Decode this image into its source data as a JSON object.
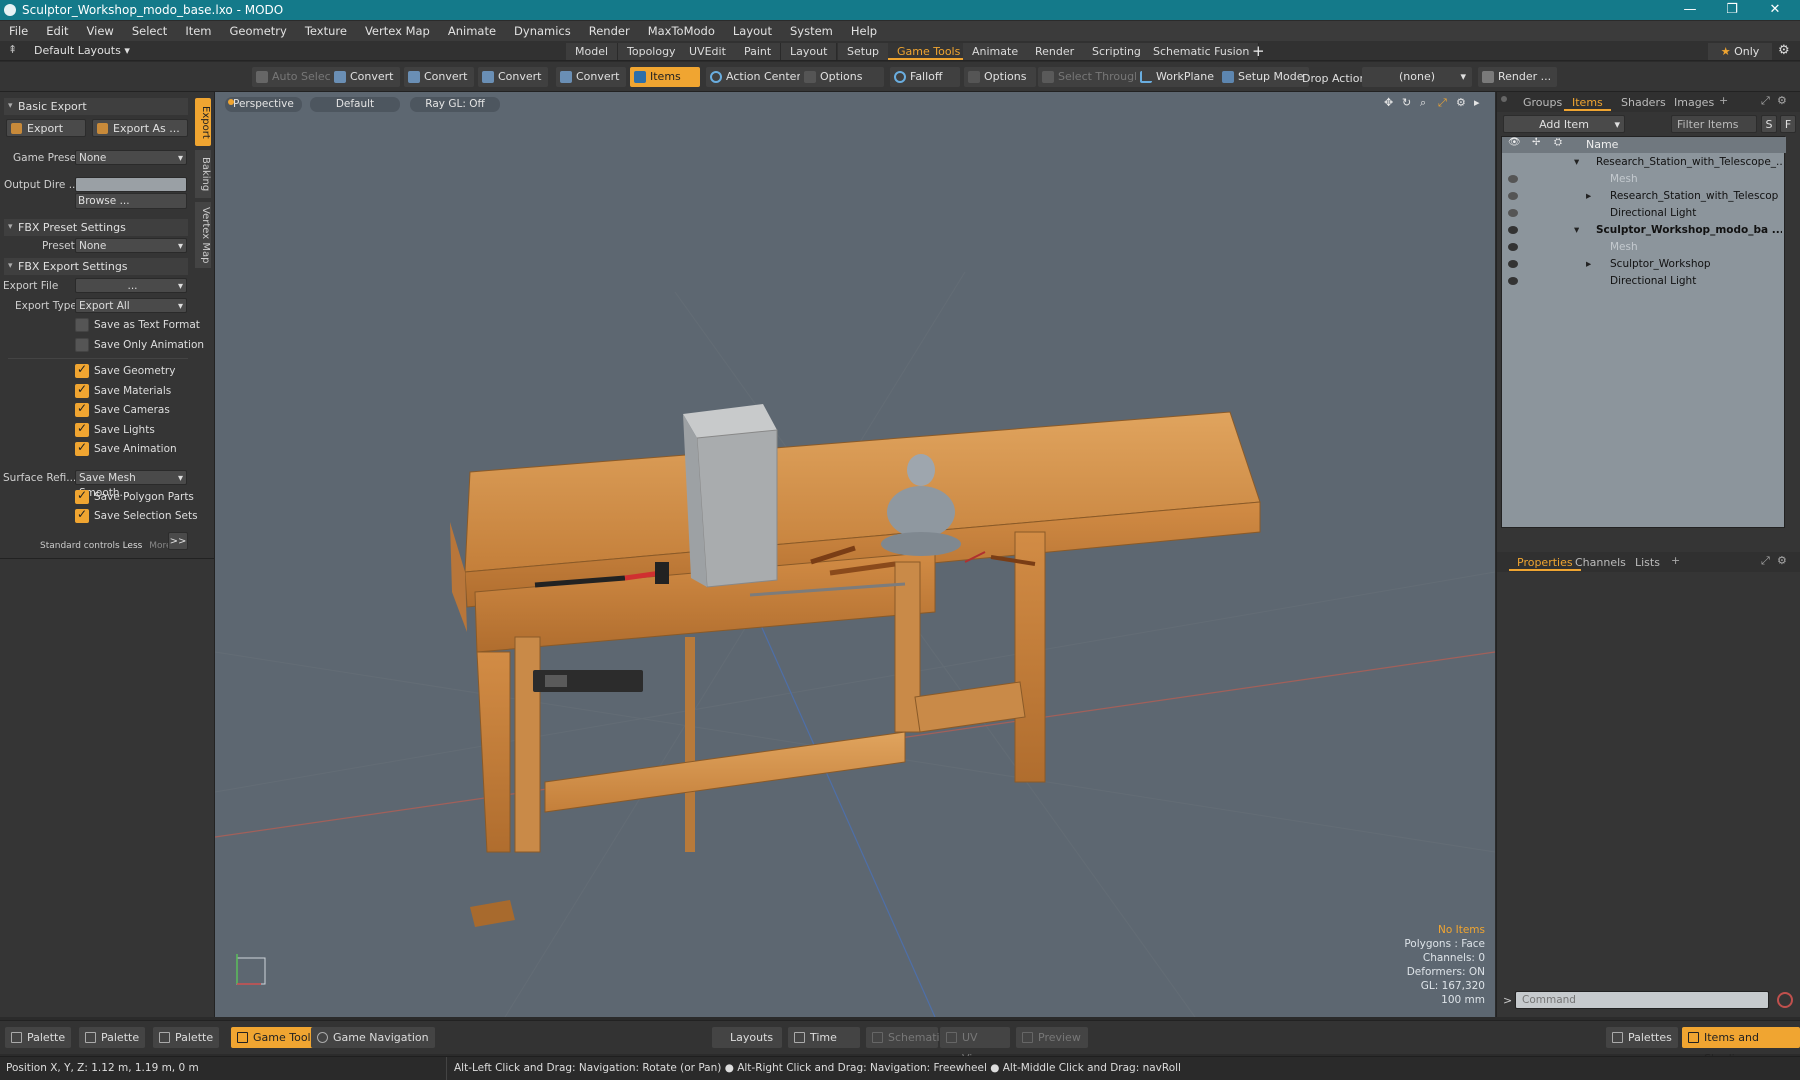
{
  "window": {
    "title": "Sculptor_Workshop_modo_base.lxo - MODO"
  },
  "menu": [
    "File",
    "Edit",
    "View",
    "Select",
    "Item",
    "Geometry",
    "Texture",
    "Vertex Map",
    "Animate",
    "Dynamics",
    "Render",
    "MaxToModo",
    "Layout",
    "System",
    "Help"
  ],
  "layout_bar": {
    "preset": "Default Layouts",
    "tabs": [
      "Model",
      "Topology",
      "UVEdit",
      "Paint",
      "Layout",
      "Setup",
      "Game Tools",
      "Animate",
      "Render",
      "Scripting",
      "Schematic Fusion"
    ],
    "add": "+",
    "only": "Only"
  },
  "toolbar": {
    "auto_select": "Auto Select",
    "convert1": "Convert",
    "convert2": "Convert",
    "convert3": "Convert",
    "convert4": "Convert",
    "items": "Items",
    "action_center": "Action Center",
    "options1": "Options",
    "falloff": "Falloff",
    "options2": "Options",
    "select_through": "Select Through",
    "workplane": "WorkPlane",
    "setup_mode": "Setup Mode",
    "drop_action_label": "Drop Action",
    "drop_action_value": "(none)",
    "render": "Render ..."
  },
  "left": {
    "basic_export": "Basic Export",
    "export_btn": "Export",
    "export_as_btn": "Export As ...",
    "game_preset_label": "Game Preset",
    "game_preset_value": "None",
    "output_dir_label": "Output Dire ...",
    "browse": "Browse ...",
    "fbx_preset_settings": "FBX Preset Settings",
    "preset_label": "Preset",
    "preset_value": "None",
    "fbx_export_settings": "FBX Export Settings",
    "export_file_label": "Export File",
    "export_file_value": "...",
    "export_type_label": "Export Type",
    "export_type_value": "Export All",
    "checks": [
      {
        "label": "Save as Text Format",
        "on": false
      },
      {
        "label": "Save Only Animation",
        "on": false
      },
      {
        "label": "Save Geometry",
        "on": true
      },
      {
        "label": "Save Materials",
        "on": true
      },
      {
        "label": "Save Cameras",
        "on": true
      },
      {
        "label": "Save Lights",
        "on": true
      },
      {
        "label": "Save Animation",
        "on": true
      }
    ],
    "surface_label": "Surface Refi...",
    "surface_value": "Save Mesh Smooth...",
    "checks2": [
      {
        "label": "Save Polygon Parts",
        "on": true
      },
      {
        "label": "Save Selection Sets",
        "on": true
      }
    ],
    "std_controls": "Standard controls",
    "less": "Less",
    "more": "More",
    "expand": ">>",
    "side_tabs": [
      "Export",
      "Baking",
      "Vertex Map"
    ]
  },
  "viewport": {
    "view": "Perspective",
    "shading": "Default",
    "raygl": "Ray GL: Off",
    "info": {
      "no_items": "No Items",
      "polygons": "Polygons : Face",
      "channels": "Channels: 0",
      "deformers": "Deformers: ON",
      "gl": "GL: 167,320",
      "scale": "100 mm"
    }
  },
  "right": {
    "tabs": [
      "Groups",
      "Items",
      "Shaders",
      "Images"
    ],
    "add_item": "Add Item",
    "filter_items": "Filter Items",
    "s": "S",
    "f": "F",
    "name_col": "Name",
    "items": [
      {
        "name": "Research_Station_with_Telescope_...",
        "indent": 0,
        "bold": false,
        "arrow": "▾"
      },
      {
        "name": "Mesh",
        "indent": 1,
        "bold": false,
        "arrow": "",
        "dim": true
      },
      {
        "name": "Research_Station_with_Telescop ...",
        "indent": 1,
        "bold": false,
        "arrow": "▸"
      },
      {
        "name": "Directional Light",
        "indent": 1,
        "bold": false,
        "arrow": ""
      },
      {
        "name": "Sculptor_Workshop_modo_ba ...",
        "indent": 0,
        "bold": true,
        "arrow": "▾"
      },
      {
        "name": "Mesh",
        "indent": 1,
        "bold": false,
        "arrow": "",
        "dim": true
      },
      {
        "name": "Sculptor_Workshop",
        "indent": 1,
        "bold": false,
        "arrow": "▸"
      },
      {
        "name": "Directional Light",
        "indent": 1,
        "bold": false,
        "arrow": ""
      }
    ],
    "prop_tabs": [
      "Properties",
      "Channels",
      "Lists"
    ],
    "command_placeholder": "Command",
    "prompt": ">"
  },
  "bottom": {
    "palette1": "Palette",
    "palette2": "Palette",
    "palette3": "Palette",
    "game_tools": "Game Tools",
    "game_nav": "Game Navigation",
    "layouts": "Layouts",
    "time": "Time",
    "schematic": "Schematic",
    "uv_view": "UV View",
    "preview": "Preview",
    "palettes": "Palettes",
    "items_shading": "Items and Shading"
  },
  "status": {
    "position": "Position X, Y, Z:   1.12 m, 1.19 m, 0 m",
    "hint": "Alt-Left Click and Drag: Navigation: Rotate (or Pan) ● Alt-Right Click and Drag: Navigation: Freewheel ● Alt-Middle Click and Drag: navRoll"
  },
  "colors": {
    "accent": "#f0a531",
    "titlebar": "#147a8a",
    "viewport": "#5d6771",
    "itemlist": "#8c959c"
  }
}
